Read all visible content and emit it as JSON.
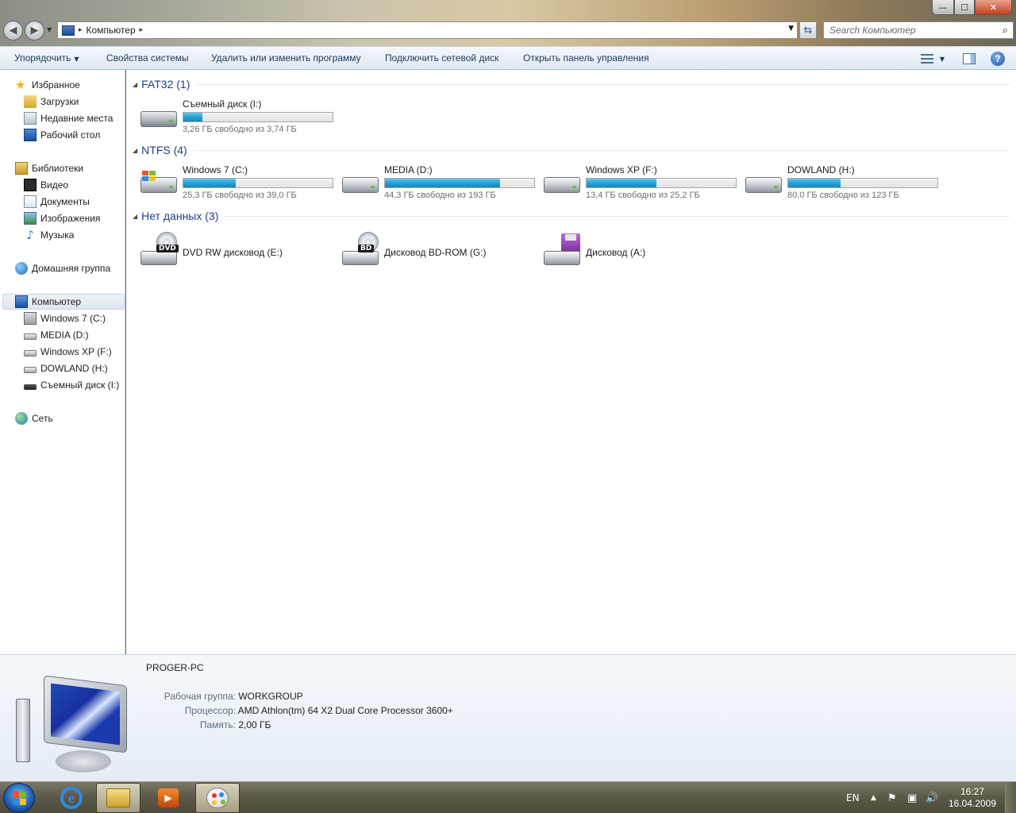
{
  "window": {
    "min_glyph": "—",
    "max_glyph": "☐",
    "close_glyph": "✕"
  },
  "address": {
    "location": "Компьютер",
    "arrow": "▸"
  },
  "search": {
    "placeholder": "Search Компьютер"
  },
  "toolbar": {
    "organize": "Упорядочить",
    "system_properties": "Свойства системы",
    "uninstall": "Удалить или изменить программу",
    "map_drive": "Подключить сетевой диск",
    "control_panel": "Открыть панель управления",
    "help": "?"
  },
  "sidebar": {
    "favorites": "Избранное",
    "downloads": "Загрузки",
    "recent": "Недавние места",
    "desktop": "Рабочий стол",
    "libraries": "Библиотеки",
    "video": "Видео",
    "documents": "Документы",
    "pictures": "Изображения",
    "music": "Музыка",
    "homegroup": "Домашняя группа",
    "computer": "Компьютер",
    "drive_c": "Windows 7 (C:)",
    "drive_d": "MEDIA (D:)",
    "drive_f": "Windows XP (F:)",
    "drive_h": "DOWLAND (H:)",
    "drive_i": "Съемный диск (I:)",
    "network": "Сеть"
  },
  "groups": {
    "fat32": "FAT32 (1)",
    "ntfs": "NTFS (4)",
    "nodata": "Нет данных (3)"
  },
  "drives": {
    "i": {
      "name": "Съемный диск (I:)",
      "free": "3,26 ГБ свободно из 3,74 ГБ",
      "used_fraction": 0.13
    },
    "c": {
      "name": "Windows 7 (C:)",
      "free": "25,3 ГБ свободно из 39,0 ГБ",
      "used_fraction": 0.35
    },
    "d": {
      "name": "MEDIA (D:)",
      "free": "44,3 ГБ свободно из 193 ГБ",
      "used_fraction": 0.77
    },
    "f": {
      "name": "Windows XP (F:)",
      "free": "13,4 ГБ свободно из 25,2 ГБ",
      "used_fraction": 0.47
    },
    "h": {
      "name": "DOWLAND (H:)",
      "free": "80,0 ГБ свободно из 123 ГБ",
      "used_fraction": 0.35
    }
  },
  "removable": {
    "dvd": {
      "name": "DVD RW дисковод (E:)",
      "badge": "DVD"
    },
    "bd": {
      "name": "Дисковод BD-ROM (G:)",
      "badge": "BD"
    },
    "floppy": {
      "name": "Дисковод (A:)"
    }
  },
  "details": {
    "computer_name": "PROGER-PC",
    "workgroup_label": "Рабочая группа:",
    "workgroup_value": "WORKGROUP",
    "cpu_label": "Процессор:",
    "cpu_value": "AMD Athlon(tm) 64 X2 Dual Core Processor 3600+",
    "ram_label": "Память:",
    "ram_value": "2,00 ГБ"
  },
  "taskbar": {
    "language": "EN",
    "time": "16:27",
    "date": "16.04.2009",
    "ie_letter": "e",
    "media_glyph": "▶"
  },
  "colors": {
    "bar_fill": "#26a0da",
    "group_title": "#1e3f8a",
    "taskbar": "#5e5a49"
  }
}
